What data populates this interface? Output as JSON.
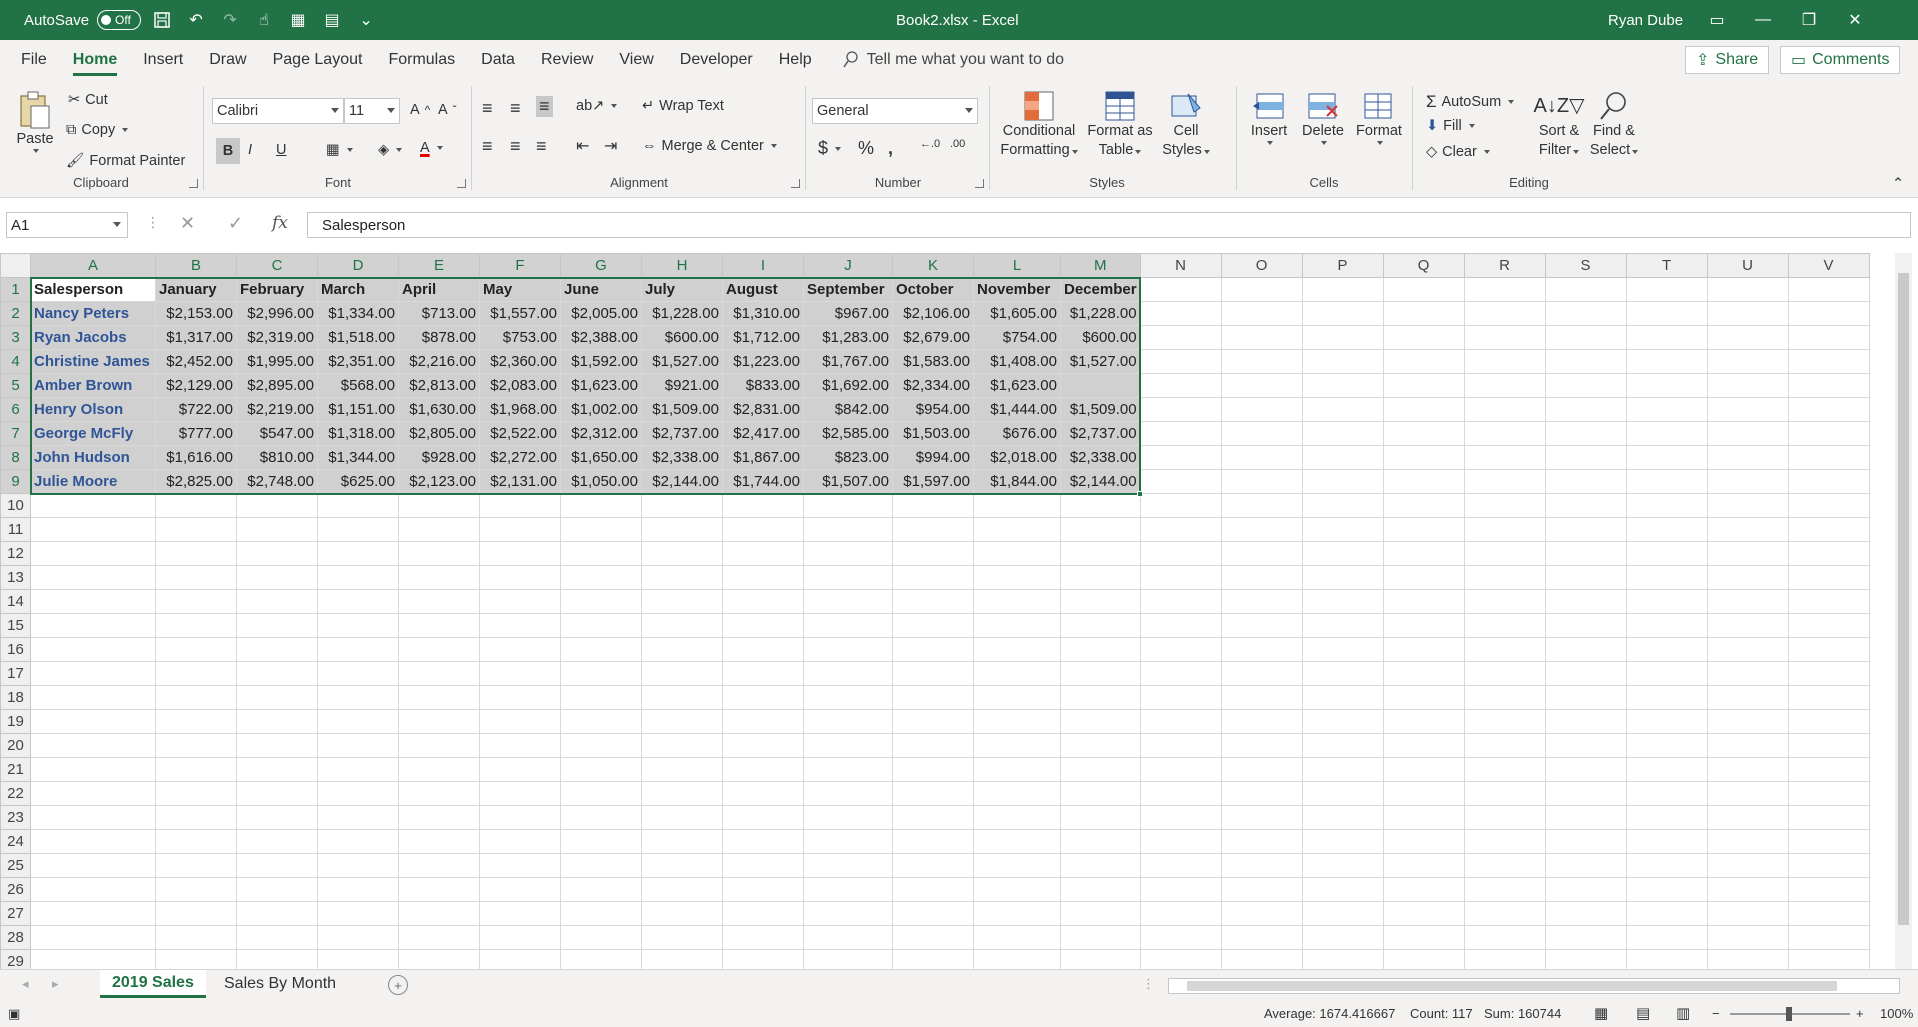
{
  "titlebar": {
    "autosave_label": "AutoSave",
    "autosave_state": "Off",
    "title": "Book2.xlsx  -  Excel",
    "user": "Ryan Dube"
  },
  "tabs": [
    "File",
    "Home",
    "Insert",
    "Draw",
    "Page Layout",
    "Formulas",
    "Data",
    "Review",
    "View",
    "Developer",
    "Help"
  ],
  "tell_me": "Tell me what you want to do",
  "share": "Share",
  "comments": "Comments",
  "ribbon": {
    "clipboard": {
      "label": "Clipboard",
      "paste": "Paste",
      "cut": "Cut",
      "copy": "Copy",
      "format_painter": "Format Painter"
    },
    "font": {
      "label": "Font",
      "name": "Calibri",
      "size": "11",
      "bold": "B",
      "italic": "I",
      "underline": "U"
    },
    "alignment": {
      "label": "Alignment",
      "wrap": "Wrap Text",
      "merge": "Merge & Center"
    },
    "number": {
      "label": "Number",
      "format": "General"
    },
    "styles": {
      "label": "Styles",
      "cond1": "Conditional",
      "cond2": "Formatting",
      "fmt1": "Format as",
      "fmt2": "Table",
      "cell1": "Cell",
      "cell2": "Styles"
    },
    "cells": {
      "label": "Cells",
      "insert": "Insert",
      "delete": "Delete",
      "format": "Format"
    },
    "editing": {
      "label": "Editing",
      "autosum": "AutoSum",
      "fill": "Fill",
      "clear": "Clear",
      "sort1": "Sort &",
      "sort2": "Filter",
      "find1": "Find &",
      "find2": "Select"
    }
  },
  "formula_bar": {
    "name_box": "A1",
    "fx": "fx",
    "content": "Salesperson"
  },
  "grid": {
    "columns": [
      "A",
      "B",
      "C",
      "D",
      "E",
      "F",
      "G",
      "H",
      "I",
      "J",
      "K",
      "L",
      "M",
      "N",
      "O",
      "P",
      "Q",
      "R",
      "S",
      "T",
      "U",
      "V"
    ],
    "header_row": [
      "Salesperson",
      "January",
      "February",
      "March",
      "April",
      "May",
      "June",
      "July",
      "August",
      "September",
      "October",
      "November",
      "December"
    ],
    "rows": [
      [
        "Nancy Peters",
        "$2,153.00",
        "$2,996.00",
        "$1,334.00",
        "$713.00",
        "$1,557.00",
        "$2,005.00",
        "$1,228.00",
        "$1,310.00",
        "$967.00",
        "$2,106.00",
        "$1,605.00",
        "$1,228.00"
      ],
      [
        "Ryan Jacobs",
        "$1,317.00",
        "$2,319.00",
        "$1,518.00",
        "$878.00",
        "$753.00",
        "$2,388.00",
        "$600.00",
        "$1,712.00",
        "$1,283.00",
        "$2,679.00",
        "$754.00",
        "$600.00"
      ],
      [
        "Christine James",
        "$2,452.00",
        "$1,995.00",
        "$2,351.00",
        "$2,216.00",
        "$2,360.00",
        "$1,592.00",
        "$1,527.00",
        "$1,223.00",
        "$1,767.00",
        "$1,583.00",
        "$1,408.00",
        "$1,527.00"
      ],
      [
        "Amber Brown",
        "$2,129.00",
        "$2,895.00",
        "$568.00",
        "$2,813.00",
        "$2,083.00",
        "$1,623.00",
        "$921.00",
        "$833.00",
        "$1,692.00",
        "$2,334.00",
        "$1,623.00",
        ""
      ],
      [
        "Henry Olson",
        "$722.00",
        "$2,219.00",
        "$1,151.00",
        "$1,630.00",
        "$1,968.00",
        "$1,002.00",
        "$1,509.00",
        "$2,831.00",
        "$842.00",
        "$954.00",
        "$1,444.00",
        "$1,509.00"
      ],
      [
        "George McFly",
        "$777.00",
        "$547.00",
        "$1,318.00",
        "$2,805.00",
        "$2,522.00",
        "$2,312.00",
        "$2,737.00",
        "$2,417.00",
        "$2,585.00",
        "$1,503.00",
        "$676.00",
        "$2,737.00"
      ],
      [
        "John Hudson",
        "$1,616.00",
        "$810.00",
        "$1,344.00",
        "$928.00",
        "$2,272.00",
        "$1,650.00",
        "$2,338.00",
        "$1,867.00",
        "$823.00",
        "$994.00",
        "$2,018.00",
        "$2,338.00"
      ],
      [
        "Julie Moore",
        "$2,825.00",
        "$2,748.00",
        "$625.00",
        "$2,123.00",
        "$2,131.00",
        "$1,050.00",
        "$2,144.00",
        "$1,744.00",
        "$1,507.00",
        "$1,597.00",
        "$1,844.00",
        "$2,144.00"
      ]
    ],
    "row_count": 29
  },
  "sheets": [
    "2019 Sales",
    "Sales By Month"
  ],
  "status": {
    "average": "Average: 1674.416667",
    "count": "Count: 117",
    "sum": "Sum: 160744",
    "zoom": "100%"
  },
  "colors": {
    "accent": "#217346",
    "name_text": "#2f5597",
    "selection_fill": "#d0d0d0"
  }
}
